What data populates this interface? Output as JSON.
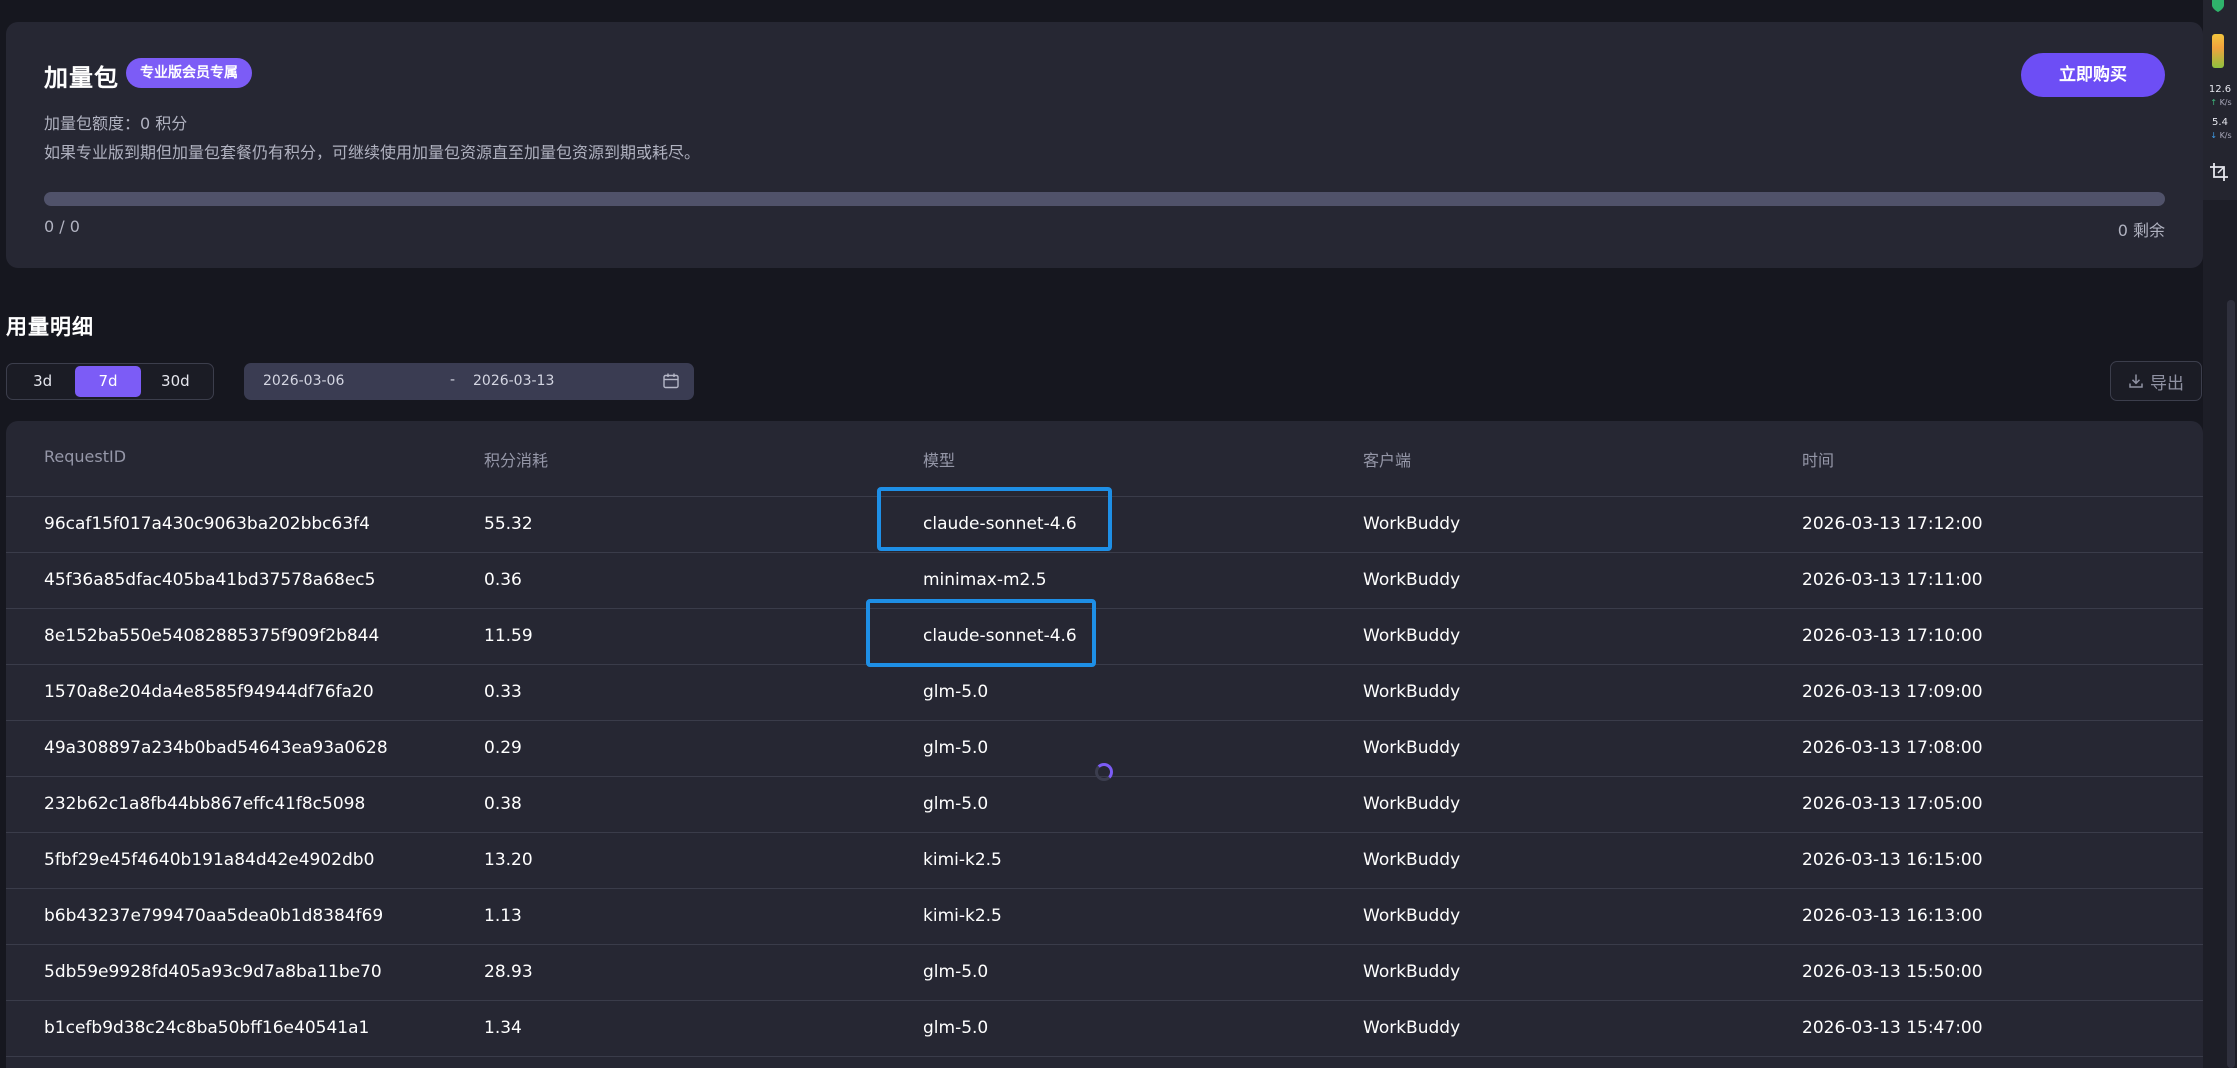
{
  "addon": {
    "title": "加量包",
    "badge": "专业版会员专属",
    "buy_label": "立即购买",
    "quota_text": "加量包额度：0 积分",
    "note_text": "如果专业版到期但加量包套餐仍有积分，可继续使用加量包资源直至加量包资源到期或耗尽。",
    "progress_fraction": 0,
    "used_text": "0 / 0",
    "remaining_text": "0 剩余"
  },
  "usage": {
    "title": "用量明细",
    "ranges": [
      "3d",
      "7d",
      "30d"
    ],
    "active_range": "7d",
    "date_start": "2026-03-06",
    "date_separator": "-",
    "date_end": "2026-03-13",
    "export_label": "导出"
  },
  "table": {
    "headers": [
      "RequestID",
      "积分消耗",
      "模型",
      "客户端",
      "时间"
    ],
    "rows": [
      [
        "96caf15f017a430c9063ba202bbc63f4",
        "55.32",
        "claude-sonnet-4.6",
        "WorkBuddy",
        "2026-03-13 17:12:00"
      ],
      [
        "45f36a85dfac405ba41bd37578a68ec5",
        "0.36",
        "minimax-m2.5",
        "WorkBuddy",
        "2026-03-13 17:11:00"
      ],
      [
        "8e152ba550e54082885375f909f2b844",
        "11.59",
        "claude-sonnet-4.6",
        "WorkBuddy",
        "2026-03-13 17:10:00"
      ],
      [
        "1570a8e204da4e8585f94944df76fa20",
        "0.33",
        "glm-5.0",
        "WorkBuddy",
        "2026-03-13 17:09:00"
      ],
      [
        "49a308897a234b0bad54643ea93a0628",
        "0.29",
        "glm-5.0",
        "WorkBuddy",
        "2026-03-13 17:08:00"
      ],
      [
        "232b62c1a8fb44bb867effc41f8c5098",
        "0.38",
        "glm-5.0",
        "WorkBuddy",
        "2026-03-13 17:05:00"
      ],
      [
        "5fbf29e45f4640b191a84d42e4902db0",
        "13.20",
        "kimi-k2.5",
        "WorkBuddy",
        "2026-03-13 16:15:00"
      ],
      [
        "b6b43237e799470aa5dea0b1d8384f69",
        "1.13",
        "kimi-k2.5",
        "WorkBuddy",
        "2026-03-13 16:13:00"
      ],
      [
        "5db59e9928fd405a93c9d7a8ba11be70",
        "28.93",
        "glm-5.0",
        "WorkBuddy",
        "2026-03-13 15:50:00"
      ],
      [
        "b1cefb9d38c24c8ba50bff16e40541a1",
        "1.34",
        "glm-5.0",
        "WorkBuddy",
        "2026-03-13 15:47:00"
      ]
    ]
  },
  "side_widget": {
    "upload_speed": "12.6",
    "upload_unit": "K/s",
    "download_speed": "5.4",
    "download_unit": "K/s"
  },
  "colors": {
    "accent": "#7c5cf6",
    "highlight": "#1e8fe6",
    "background": "#16171f",
    "card": "#262733"
  }
}
